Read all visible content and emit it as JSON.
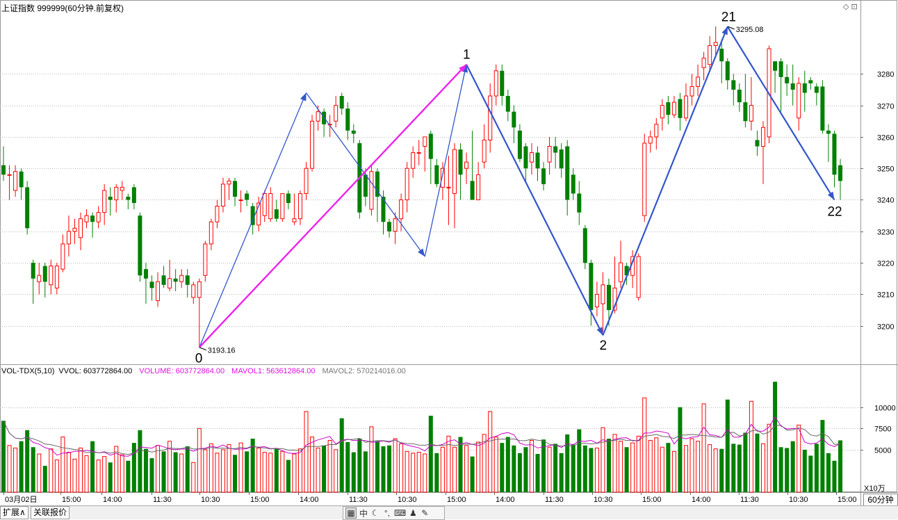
{
  "header": {
    "title": "上证指数 999999(60分钟.前复权)",
    "win_icons": "◇ ⊡"
  },
  "volume_header": {
    "indicator": "VOL-TDX(5,10)",
    "vvol": "VVOL: 603772864.00",
    "volume": "VOLUME: 603772864.00",
    "mavol1": "MAVOL1: 563612864.00",
    "mavol2": "MAVOL2: 570214016.00"
  },
  "volume_unit": "X10万",
  "period_label": "60分钟",
  "bottom_tabs": {
    "expand": "扩展∧",
    "quote": "关联报价"
  },
  "toolbar_icons": [
    "grid-icon",
    "zhong-icon",
    "moon-icon",
    "dots-icon",
    "keyboard-icon",
    "user-icon",
    "wrench-icon"
  ],
  "toolbar_text": {
    "zhong": "中"
  },
  "colors": {
    "up": "#ff0000",
    "down": "#008000",
    "wave": "#3355cc",
    "wave_main": "#ee22ee",
    "ma1": "#cc00cc",
    "ma2": "#666666"
  },
  "chart_data": {
    "type": "candlestick",
    "price_axis": {
      "ticks": [
        3200,
        3210,
        3220,
        3230,
        3240,
        3250,
        3260,
        3270,
        3280
      ],
      "range": [
        3190,
        3300
      ]
    },
    "volume_axis": {
      "ticks": [
        5000,
        7500,
        10000
      ],
      "range": [
        0,
        12500
      ],
      "unit": "X10万"
    },
    "x_ticks": [
      "03月02日",
      "15:00",
      "14:00",
      "11:30",
      "10:30",
      "15:00",
      "14:00",
      "11:30",
      "10:30",
      "15:00",
      "14:00",
      "11:30",
      "10:30",
      "15:00",
      "14:00",
      "11:30",
      "10:30",
      "15:00"
    ],
    "annotations": [
      {
        "label": "0",
        "value": 3193.16,
        "text": "3193.16"
      },
      {
        "label": "1"
      },
      {
        "label": "2"
      },
      {
        "label": "21",
        "value": 3295.08,
        "text": "3295.08"
      },
      {
        "label": "22"
      }
    ],
    "candles": [
      {
        "o": 3251,
        "c": 3248,
        "h": 3257,
        "l": 3246,
        "v": 8400
      },
      {
        "o": 3248,
        "c": 3248,
        "h": 3251,
        "l": 3240,
        "v": 5500
      },
      {
        "o": 3243,
        "c": 3249,
        "h": 3251,
        "l": 3241,
        "v": 5200
      },
      {
        "o": 3249,
        "c": 3244,
        "h": 3250,
        "l": 3240,
        "v": 6000
      },
      {
        "o": 3244,
        "c": 3231,
        "h": 3246,
        "l": 3229,
        "v": 7300
      },
      {
        "o": 3220,
        "c": 3215,
        "h": 3221,
        "l": 3207,
        "v": 5300
      },
      {
        "o": 3214,
        "c": 3216,
        "h": 3220,
        "l": 3210,
        "v": 4500
      },
      {
        "o": 3219,
        "c": 3214,
        "h": 3220,
        "l": 3209,
        "v": 3100
      },
      {
        "o": 3213,
        "c": 3219,
        "h": 3221,
        "l": 3210,
        "v": 5100
      },
      {
        "o": 3212,
        "c": 3219,
        "h": 3220,
        "l": 3210,
        "v": 3800
      },
      {
        "o": 3218,
        "c": 3226,
        "h": 3229,
        "l": 3217,
        "v": 6500
      },
      {
        "o": 3226,
        "c": 3230,
        "h": 3235,
        "l": 3222,
        "v": 4700
      },
      {
        "o": 3230,
        "c": 3231,
        "h": 3234,
        "l": 3226,
        "v": 3900
      },
      {
        "o": 3228,
        "c": 3234,
        "h": 3236,
        "l": 3224,
        "v": 5200
      },
      {
        "o": 3233,
        "c": 3235,
        "h": 3237,
        "l": 3231,
        "v": 4300
      },
      {
        "o": 3235,
        "c": 3233,
        "h": 3236,
        "l": 3228,
        "v": 6000
      },
      {
        "o": 3233,
        "c": 3236,
        "h": 3238,
        "l": 3231,
        "v": 3800
      },
      {
        "o": 3236,
        "c": 3243,
        "h": 3245,
        "l": 3232,
        "v": 4200
      },
      {
        "o": 3241,
        "c": 3240,
        "h": 3244,
        "l": 3235,
        "v": 3500
      },
      {
        "o": 3240,
        "c": 3244,
        "h": 3245,
        "l": 3236,
        "v": 5400
      },
      {
        "o": 3243,
        "c": 3244,
        "h": 3246,
        "l": 3240,
        "v": 4400
      },
      {
        "o": 3241,
        "c": 3240,
        "h": 3242,
        "l": 3237,
        "v": 3700
      },
      {
        "o": 3244,
        "c": 3239,
        "h": 3245,
        "l": 3237,
        "v": 5800
      },
      {
        "o": 3235,
        "c": 3216,
        "h": 3236,
        "l": 3214,
        "v": 7300
      },
      {
        "o": 3218,
        "c": 3215,
        "h": 3220,
        "l": 3207,
        "v": 5100
      },
      {
        "o": 3214,
        "c": 3212,
        "h": 3216,
        "l": 3208,
        "v": 4000
      },
      {
        "o": 3208,
        "c": 3214,
        "h": 3217,
        "l": 3206,
        "v": 5500
      },
      {
        "o": 3216,
        "c": 3213,
        "h": 3219,
        "l": 3212,
        "v": 4800
      },
      {
        "o": 3212,
        "c": 3215,
        "h": 3221,
        "l": 3211,
        "v": 6000
      },
      {
        "o": 3215,
        "c": 3214,
        "h": 3218,
        "l": 3211,
        "v": 4700
      },
      {
        "o": 3214,
        "c": 3216,
        "h": 3218,
        "l": 3212,
        "v": 4500
      },
      {
        "o": 3216,
        "c": 3213,
        "h": 3218,
        "l": 3209,
        "v": 5400
      },
      {
        "o": 3209,
        "c": 3213,
        "h": 3214,
        "l": 3207,
        "v": 3500
      },
      {
        "o": 3209,
        "c": 3214,
        "h": 3215,
        "l": 3193.16,
        "v": 7500
      },
      {
        "o": 3216,
        "c": 3226,
        "h": 3227,
        "l": 3214,
        "v": 5000
      },
      {
        "o": 3226,
        "c": 3233,
        "h": 3234,
        "l": 3224,
        "v": 5700
      },
      {
        "o": 3233,
        "c": 3238,
        "h": 3240,
        "l": 3231,
        "v": 4600
      },
      {
        "o": 3238,
        "c": 3245,
        "h": 3247,
        "l": 3236,
        "v": 5000
      },
      {
        "o": 3245,
        "c": 3246,
        "h": 3247,
        "l": 3240,
        "v": 5600
      },
      {
        "o": 3246,
        "c": 3241,
        "h": 3247,
        "l": 3238,
        "v": 4400
      },
      {
        "o": 3240,
        "c": 3240,
        "h": 3243,
        "l": 3236,
        "v": 5800
      },
      {
        "o": 3242,
        "c": 3240,
        "h": 3243,
        "l": 3238,
        "v": 4800
      },
      {
        "o": 3238,
        "c": 3232,
        "h": 3239,
        "l": 3229,
        "v": 6300
      },
      {
        "o": 3232,
        "c": 3239,
        "h": 3241,
        "l": 3230,
        "v": 5200
      },
      {
        "o": 3235,
        "c": 3242,
        "h": 3243,
        "l": 3233,
        "v": 4700
      },
      {
        "o": 3234,
        "c": 3242,
        "h": 3244,
        "l": 3233,
        "v": 4600
      },
      {
        "o": 3237,
        "c": 3234,
        "h": 3240,
        "l": 3233,
        "v": 5100
      },
      {
        "o": 3234,
        "c": 3242,
        "h": 3242,
        "l": 3233,
        "v": 4800
      },
      {
        "o": 3242,
        "c": 3239,
        "h": 3243,
        "l": 3237,
        "v": 3800
      },
      {
        "o": 3233,
        "c": 3234,
        "h": 3242,
        "l": 3232,
        "v": 4500
      },
      {
        "o": 3234,
        "c": 3242,
        "h": 3243,
        "l": 3232,
        "v": 5100
      },
      {
        "o": 3242,
        "c": 3250,
        "h": 3252,
        "l": 3240,
        "v": 9500
      },
      {
        "o": 3250,
        "c": 3265,
        "h": 3267,
        "l": 3249,
        "v": 6500
      },
      {
        "o": 3265,
        "c": 3268,
        "h": 3270,
        "l": 3262,
        "v": 5200
      },
      {
        "o": 3268,
        "c": 3264,
        "h": 3269,
        "l": 3260,
        "v": 5500
      },
      {
        "o": 3264,
        "c": 3264,
        "h": 3267,
        "l": 3260,
        "v": 6100
      },
      {
        "o": 3265,
        "c": 3270,
        "h": 3273,
        "l": 3263,
        "v": 5000
      },
      {
        "o": 3273,
        "c": 3269,
        "h": 3274,
        "l": 3267,
        "v": 8700
      },
      {
        "o": 3269,
        "c": 3262,
        "h": 3271,
        "l": 3259,
        "v": 5900
      },
      {
        "o": 3262,
        "c": 3261,
        "h": 3264,
        "l": 3258,
        "v": 4700
      },
      {
        "o": 3258,
        "c": 3236,
        "h": 3259,
        "l": 3234,
        "v": 6300
      },
      {
        "o": 3248,
        "c": 3241,
        "h": 3250,
        "l": 3238,
        "v": 4800
      },
      {
        "o": 3237,
        "c": 3249,
        "h": 3251,
        "l": 3235,
        "v": 7700
      },
      {
        "o": 3249,
        "c": 3241,
        "h": 3250,
        "l": 3233,
        "v": 6000
      },
      {
        "o": 3241,
        "c": 3233,
        "h": 3243,
        "l": 3229,
        "v": 5400
      },
      {
        "o": 3233,
        "c": 3230,
        "h": 3234,
        "l": 3228,
        "v": 5500
      },
      {
        "o": 3230,
        "c": 3234,
        "h": 3236,
        "l": 3226,
        "v": 6300
      },
      {
        "o": 3234,
        "c": 3240,
        "h": 3242,
        "l": 3230,
        "v": 5700
      },
      {
        "o": 3240,
        "c": 3250,
        "h": 3252,
        "l": 3236,
        "v": 4800
      },
      {
        "o": 3250,
        "c": 3255,
        "h": 3257,
        "l": 3247,
        "v": 4600
      },
      {
        "o": 3255,
        "c": 3255,
        "h": 3259,
        "l": 3251,
        "v": 4700
      },
      {
        "o": 3257,
        "c": 3260,
        "h": 3260,
        "l": 3249,
        "v": 4500
      },
      {
        "o": 3261,
        "c": 3253,
        "h": 3262,
        "l": 3245,
        "v": 9000
      },
      {
        "o": 3251,
        "c": 3245,
        "h": 3253,
        "l": 3244,
        "v": 4600
      },
      {
        "o": 3244,
        "c": 3250,
        "h": 3252,
        "l": 3240,
        "v": 5300
      },
      {
        "o": 3244,
        "c": 3244,
        "h": 3254,
        "l": 3232,
        "v": 6600
      },
      {
        "o": 3242,
        "c": 3256,
        "h": 3258,
        "l": 3231,
        "v": 5300
      },
      {
        "o": 3256,
        "c": 3248,
        "h": 3258,
        "l": 3240,
        "v": 6500
      },
      {
        "o": 3250,
        "c": 3252,
        "h": 3255,
        "l": 3245,
        "v": 5500
      },
      {
        "o": 3246,
        "c": 3240,
        "h": 3262,
        "l": 3240,
        "v": 4200
      },
      {
        "o": 3240,
        "c": 3248,
        "h": 3252,
        "l": 3242,
        "v": 5900
      },
      {
        "o": 3252,
        "c": 3259,
        "h": 3264,
        "l": 3250,
        "v": 6800
      },
      {
        "o": 3259,
        "c": 3273,
        "h": 3277,
        "l": 3255,
        "v": 9500
      },
      {
        "o": 3273,
        "c": 3281,
        "h": 3283,
        "l": 3270,
        "v": 6500
      },
      {
        "o": 3281,
        "c": 3273,
        "h": 3283,
        "l": 3270,
        "v": 5800
      },
      {
        "o": 3273,
        "c": 3268,
        "h": 3275,
        "l": 3265,
        "v": 6500
      },
      {
        "o": 3268,
        "c": 3263,
        "h": 3270,
        "l": 3258,
        "v": 5500
      },
      {
        "o": 3262,
        "c": 3253,
        "h": 3264,
        "l": 3252,
        "v": 4600
      },
      {
        "o": 3257,
        "c": 3250,
        "h": 3258,
        "l": 3246,
        "v": 5300
      },
      {
        "o": 3252,
        "c": 3255,
        "h": 3258,
        "l": 3248,
        "v": 6100
      },
      {
        "o": 3255,
        "c": 3250,
        "h": 3257,
        "l": 3246,
        "v": 4500
      },
      {
        "o": 3250,
        "c": 3245,
        "h": 3252,
        "l": 3243,
        "v": 6200
      },
      {
        "o": 3252,
        "c": 3257,
        "h": 3260,
        "l": 3248,
        "v": 5300
      },
      {
        "o": 3257,
        "c": 3255,
        "h": 3260,
        "l": 3250,
        "v": 5700
      },
      {
        "o": 3256,
        "c": 3250,
        "h": 3258,
        "l": 3247,
        "v": 4600
      },
      {
        "o": 3257,
        "c": 3240,
        "h": 3259,
        "l": 3235,
        "v": 6800
      },
      {
        "o": 3248,
        "c": 3242,
        "h": 3250,
        "l": 3240,
        "v": 5600
      },
      {
        "o": 3242,
        "c": 3236,
        "h": 3246,
        "l": 3232,
        "v": 7400
      },
      {
        "o": 3231,
        "c": 3220,
        "h": 3232,
        "l": 3218,
        "v": 5500
      },
      {
        "o": 3220,
        "c": 3205,
        "h": 3221,
        "l": 3200,
        "v": 5200
      },
      {
        "o": 3206,
        "c": 3210,
        "h": 3214,
        "l": 3203,
        "v": 5200
      },
      {
        "o": 3207,
        "c": 3213,
        "h": 3217,
        "l": 3198,
        "v": 7600
      },
      {
        "o": 3213,
        "c": 3205,
        "h": 3215,
        "l": 3200,
        "v": 6300
      },
      {
        "o": 3205,
        "c": 3212,
        "h": 3222,
        "l": 3204,
        "v": 6800
      },
      {
        "o": 3214,
        "c": 3220,
        "h": 3227,
        "l": 3212,
        "v": 6000
      },
      {
        "o": 3219,
        "c": 3216,
        "h": 3220,
        "l": 3213,
        "v": 5300
      },
      {
        "o": 3216,
        "c": 3222,
        "h": 3224,
        "l": 3212,
        "v": 5800
      },
      {
        "o": 3209,
        "c": 3222,
        "h": 3223,
        "l": 3208,
        "v": 6600
      },
      {
        "o": 3235,
        "c": 3258,
        "h": 3261,
        "l": 3233,
        "v": 11100
      },
      {
        "o": 3258,
        "c": 3260,
        "h": 3262,
        "l": 3255,
        "v": 6100
      },
      {
        "o": 3260,
        "c": 3264,
        "h": 3266,
        "l": 3256,
        "v": 6400
      },
      {
        "o": 3266,
        "c": 3270,
        "h": 3272,
        "l": 3262,
        "v": 5300
      },
      {
        "o": 3271,
        "c": 3267,
        "h": 3273,
        "l": 3264,
        "v": 5800
      },
      {
        "o": 3267,
        "c": 3271,
        "h": 3273,
        "l": 3266,
        "v": 4800
      },
      {
        "o": 3272,
        "c": 3266,
        "h": 3274,
        "l": 3262,
        "v": 10000
      },
      {
        "o": 3266,
        "c": 3273,
        "h": 3277,
        "l": 3265,
        "v": 5500
      },
      {
        "o": 3273,
        "c": 3276,
        "h": 3280,
        "l": 3270,
        "v": 6300
      },
      {
        "o": 3276,
        "c": 3279,
        "h": 3283,
        "l": 3273,
        "v": 6000
      },
      {
        "o": 3282,
        "c": 3285,
        "h": 3287,
        "l": 3278,
        "v": 10400
      },
      {
        "o": 3283,
        "c": 3289,
        "h": 3292,
        "l": 3281,
        "v": 5600
      },
      {
        "o": 3289,
        "c": 3290,
        "h": 3295.08,
        "l": 3286,
        "v": 5100
      },
      {
        "o": 3288,
        "c": 3284,
        "h": 3291,
        "l": 3277,
        "v": 5100
      },
      {
        "o": 3284,
        "c": 3278,
        "h": 3285,
        "l": 3275,
        "v": 10900
      },
      {
        "o": 3278,
        "c": 3275,
        "h": 3280,
        "l": 3270,
        "v": 5700
      },
      {
        "o": 3275,
        "c": 3271,
        "h": 3277,
        "l": 3268,
        "v": 5600
      },
      {
        "o": 3271,
        "c": 3265,
        "h": 3280,
        "l": 3263,
        "v": 7000
      },
      {
        "o": 3265,
        "c": 3270,
        "h": 3279,
        "l": 3262,
        "v": 10700
      },
      {
        "o": 3259,
        "c": 3257,
        "h": 3262,
        "l": 3254,
        "v": 6900
      },
      {
        "o": 3257,
        "c": 3263,
        "h": 3265,
        "l": 3245,
        "v": 5700
      },
      {
        "o": 3260,
        "c": 3288,
        "h": 3289,
        "l": 3258,
        "v": 8000
      },
      {
        "o": 3284,
        "c": 3281,
        "h": 3284,
        "l": 3274,
        "v": 13000
      },
      {
        "o": 3284,
        "c": 3279,
        "h": 3285,
        "l": 3268,
        "v": 5300
      },
      {
        "o": 3279,
        "c": 3277,
        "h": 3283,
        "l": 3273,
        "v": 5200
      },
      {
        "o": 3277,
        "c": 3275,
        "h": 3283,
        "l": 3270,
        "v": 6000
      },
      {
        "o": 3266,
        "c": 3277,
        "h": 3279,
        "l": 3262,
        "v": 7900
      },
      {
        "o": 3277,
        "c": 3274,
        "h": 3281,
        "l": 3268,
        "v": 5000
      },
      {
        "o": 3278,
        "c": 3277,
        "h": 3279,
        "l": 3275,
        "v": 4300
      },
      {
        "o": 3276,
        "c": 3274,
        "h": 3277,
        "l": 3270,
        "v": 5700
      },
      {
        "o": 3276,
        "c": 3262,
        "h": 3278,
        "l": 3261,
        "v": 8500
      },
      {
        "o": 3262,
        "c": 3261,
        "h": 3264,
        "l": 3252,
        "v": 4600
      },
      {
        "o": 3261,
        "c": 3248,
        "h": 3262,
        "l": 3244,
        "v": 3700
      },
      {
        "o": 3251,
        "c": 3246,
        "h": 3253,
        "l": 3240,
        "v": 6100
      }
    ]
  }
}
